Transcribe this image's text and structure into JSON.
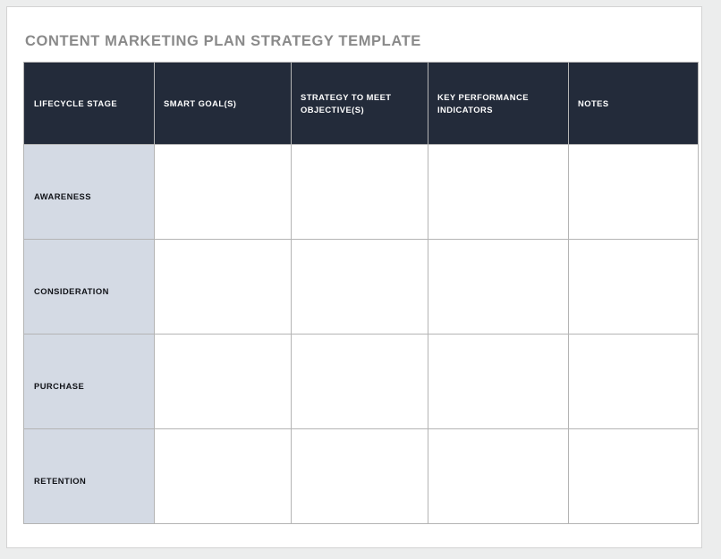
{
  "document": {
    "title": "CONTENT MARKETING PLAN STRATEGY TEMPLATE"
  },
  "colors": {
    "header_background": "#232b3a",
    "header_text": "#ffffff",
    "stage_column_background": "#d4dae4",
    "title_text": "#8a8a8a",
    "grid_line": "#b4b4b4",
    "page_background": "#ffffff",
    "canvas_background": "#eceded"
  },
  "table": {
    "columns": [
      {
        "key": "lifecycle_stage",
        "label": "LIFECYCLE STAGE"
      },
      {
        "key": "smart_goals",
        "label": "SMART GOAL(S)"
      },
      {
        "key": "strategy",
        "label": "STRATEGY TO MEET OBJECTIVE(S)"
      },
      {
        "key": "kpis",
        "label": "KEY PERFORMANCE INDICATORS"
      },
      {
        "key": "notes",
        "label": "NOTES"
      }
    ],
    "rows": [
      {
        "lifecycle_stage": "AWARENESS",
        "smart_goals": "",
        "strategy": "",
        "kpis": "",
        "notes": ""
      },
      {
        "lifecycle_stage": "CONSIDERATION",
        "smart_goals": "",
        "strategy": "",
        "kpis": "",
        "notes": ""
      },
      {
        "lifecycle_stage": "PURCHASE",
        "smart_goals": "",
        "strategy": "",
        "kpis": "",
        "notes": ""
      },
      {
        "lifecycle_stage": "RETENTION",
        "smart_goals": "",
        "strategy": "",
        "kpis": "",
        "notes": ""
      }
    ]
  }
}
